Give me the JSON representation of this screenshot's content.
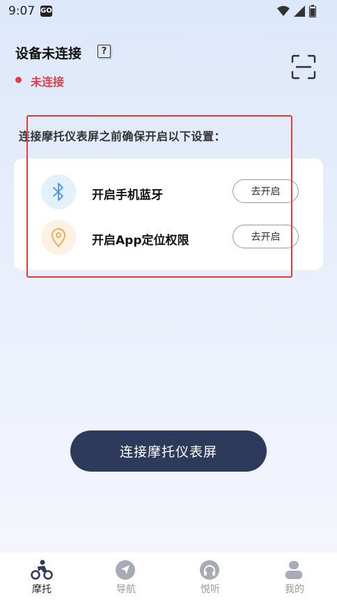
{
  "status_bar": {
    "time": "9:07",
    "app_badge": "GO"
  },
  "device": {
    "title": "设备未连接",
    "help_icon_text": "?",
    "status": "未连接"
  },
  "instruction": "连接摩托仪表屏之前确保开启以下设置：",
  "permissions": [
    {
      "label": "开启手机蓝牙",
      "button": "去开启",
      "icon": "bluetooth-icon"
    },
    {
      "label": "开启App定位权限",
      "button": "去开启",
      "icon": "location-pin-icon"
    }
  ],
  "connect_button": "连接摩托仪表屏",
  "tabs": [
    {
      "label": "摩托",
      "icon": "motorcycle-rider-icon",
      "active": true
    },
    {
      "label": "导航",
      "icon": "navigation-arrow-icon",
      "active": false
    },
    {
      "label": "悦听",
      "icon": "headphones-icon",
      "active": false
    },
    {
      "label": "我的",
      "icon": "profile-icon",
      "active": false
    }
  ],
  "colors": {
    "accent_dark": "#2e3a5c",
    "error": "#e53b4a",
    "highlight": "#e53a3a",
    "bluetooth": "#4a8ef0",
    "location": "#f0a545"
  }
}
